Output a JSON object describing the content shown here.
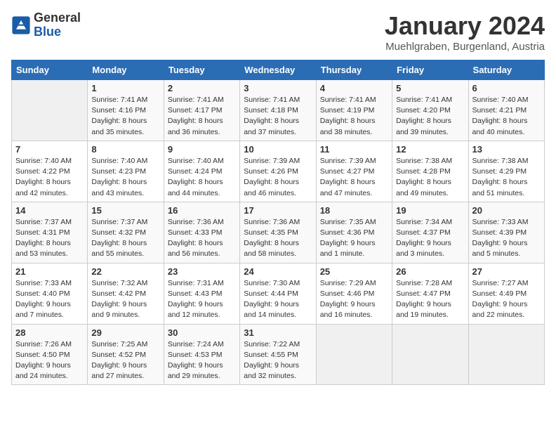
{
  "header": {
    "logo_general": "General",
    "logo_blue": "Blue",
    "title": "January 2024",
    "subtitle": "Muehlgraben, Burgenland, Austria"
  },
  "columns": [
    "Sunday",
    "Monday",
    "Tuesday",
    "Wednesday",
    "Thursday",
    "Friday",
    "Saturday"
  ],
  "weeks": [
    [
      {
        "day": "",
        "detail": ""
      },
      {
        "day": "1",
        "detail": "Sunrise: 7:41 AM\nSunset: 4:16 PM\nDaylight: 8 hours\nand 35 minutes."
      },
      {
        "day": "2",
        "detail": "Sunrise: 7:41 AM\nSunset: 4:17 PM\nDaylight: 8 hours\nand 36 minutes."
      },
      {
        "day": "3",
        "detail": "Sunrise: 7:41 AM\nSunset: 4:18 PM\nDaylight: 8 hours\nand 37 minutes."
      },
      {
        "day": "4",
        "detail": "Sunrise: 7:41 AM\nSunset: 4:19 PM\nDaylight: 8 hours\nand 38 minutes."
      },
      {
        "day": "5",
        "detail": "Sunrise: 7:41 AM\nSunset: 4:20 PM\nDaylight: 8 hours\nand 39 minutes."
      },
      {
        "day": "6",
        "detail": "Sunrise: 7:40 AM\nSunset: 4:21 PM\nDaylight: 8 hours\nand 40 minutes."
      }
    ],
    [
      {
        "day": "7",
        "detail": "Sunrise: 7:40 AM\nSunset: 4:22 PM\nDaylight: 8 hours\nand 42 minutes."
      },
      {
        "day": "8",
        "detail": "Sunrise: 7:40 AM\nSunset: 4:23 PM\nDaylight: 8 hours\nand 43 minutes."
      },
      {
        "day": "9",
        "detail": "Sunrise: 7:40 AM\nSunset: 4:24 PM\nDaylight: 8 hours\nand 44 minutes."
      },
      {
        "day": "10",
        "detail": "Sunrise: 7:39 AM\nSunset: 4:26 PM\nDaylight: 8 hours\nand 46 minutes."
      },
      {
        "day": "11",
        "detail": "Sunrise: 7:39 AM\nSunset: 4:27 PM\nDaylight: 8 hours\nand 47 minutes."
      },
      {
        "day": "12",
        "detail": "Sunrise: 7:38 AM\nSunset: 4:28 PM\nDaylight: 8 hours\nand 49 minutes."
      },
      {
        "day": "13",
        "detail": "Sunrise: 7:38 AM\nSunset: 4:29 PM\nDaylight: 8 hours\nand 51 minutes."
      }
    ],
    [
      {
        "day": "14",
        "detail": "Sunrise: 7:37 AM\nSunset: 4:31 PM\nDaylight: 8 hours\nand 53 minutes."
      },
      {
        "day": "15",
        "detail": "Sunrise: 7:37 AM\nSunset: 4:32 PM\nDaylight: 8 hours\nand 55 minutes."
      },
      {
        "day": "16",
        "detail": "Sunrise: 7:36 AM\nSunset: 4:33 PM\nDaylight: 8 hours\nand 56 minutes."
      },
      {
        "day": "17",
        "detail": "Sunrise: 7:36 AM\nSunset: 4:35 PM\nDaylight: 8 hours\nand 58 minutes."
      },
      {
        "day": "18",
        "detail": "Sunrise: 7:35 AM\nSunset: 4:36 PM\nDaylight: 9 hours\nand 1 minute."
      },
      {
        "day": "19",
        "detail": "Sunrise: 7:34 AM\nSunset: 4:37 PM\nDaylight: 9 hours\nand 3 minutes."
      },
      {
        "day": "20",
        "detail": "Sunrise: 7:33 AM\nSunset: 4:39 PM\nDaylight: 9 hours\nand 5 minutes."
      }
    ],
    [
      {
        "day": "21",
        "detail": "Sunrise: 7:33 AM\nSunset: 4:40 PM\nDaylight: 9 hours\nand 7 minutes."
      },
      {
        "day": "22",
        "detail": "Sunrise: 7:32 AM\nSunset: 4:42 PM\nDaylight: 9 hours\nand 9 minutes."
      },
      {
        "day": "23",
        "detail": "Sunrise: 7:31 AM\nSunset: 4:43 PM\nDaylight: 9 hours\nand 12 minutes."
      },
      {
        "day": "24",
        "detail": "Sunrise: 7:30 AM\nSunset: 4:44 PM\nDaylight: 9 hours\nand 14 minutes."
      },
      {
        "day": "25",
        "detail": "Sunrise: 7:29 AM\nSunset: 4:46 PM\nDaylight: 9 hours\nand 16 minutes."
      },
      {
        "day": "26",
        "detail": "Sunrise: 7:28 AM\nSunset: 4:47 PM\nDaylight: 9 hours\nand 19 minutes."
      },
      {
        "day": "27",
        "detail": "Sunrise: 7:27 AM\nSunset: 4:49 PM\nDaylight: 9 hours\nand 22 minutes."
      }
    ],
    [
      {
        "day": "28",
        "detail": "Sunrise: 7:26 AM\nSunset: 4:50 PM\nDaylight: 9 hours\nand 24 minutes."
      },
      {
        "day": "29",
        "detail": "Sunrise: 7:25 AM\nSunset: 4:52 PM\nDaylight: 9 hours\nand 27 minutes."
      },
      {
        "day": "30",
        "detail": "Sunrise: 7:24 AM\nSunset: 4:53 PM\nDaylight: 9 hours\nand 29 minutes."
      },
      {
        "day": "31",
        "detail": "Sunrise: 7:22 AM\nSunset: 4:55 PM\nDaylight: 9 hours\nand 32 minutes."
      },
      {
        "day": "",
        "detail": ""
      },
      {
        "day": "",
        "detail": ""
      },
      {
        "day": "",
        "detail": ""
      }
    ]
  ]
}
